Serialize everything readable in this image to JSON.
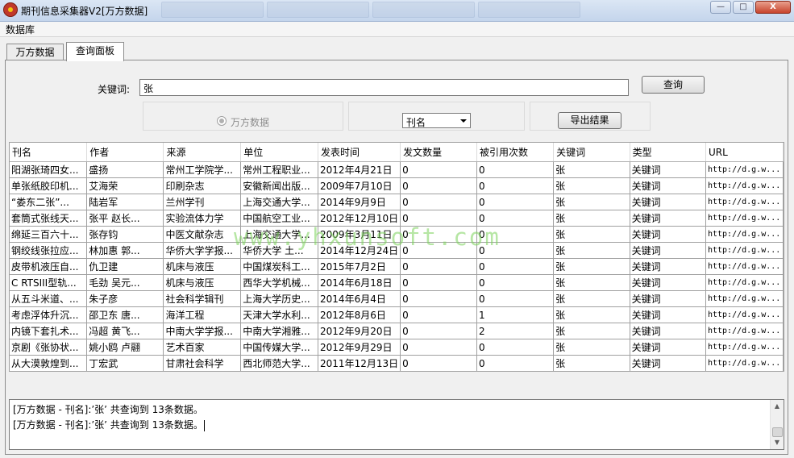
{
  "window": {
    "title": "期刊信息采集器V2[万方数据]",
    "controls": {
      "minimize": "—",
      "maximize": "□",
      "close": "X"
    }
  },
  "menu": {
    "items": [
      "数据库"
    ]
  },
  "tabs": [
    "万方数据",
    "查询面板"
  ],
  "search": {
    "label": "关键词:",
    "value": "张",
    "button": "查询"
  },
  "options": {
    "radio_label": "万方数据",
    "field_select": "刊名",
    "export_button": "导出结果"
  },
  "table": {
    "columns": [
      "刊名",
      "作者",
      "来源",
      "单位",
      "发表时间",
      "发文数量",
      "被引用次数",
      "关键词",
      "类型",
      "URL"
    ],
    "rows": [
      [
        "阳湖张琦四女...",
        "盛扬",
        "常州工学院学...",
        "常州工程职业...",
        "2012年4月21日",
        "0",
        "0",
        "张",
        "关键词",
        "http://d.g.w..."
      ],
      [
        "单张纸胶印机...",
        "艾海荣",
        "印刷杂志",
        "安徽新闻出版...",
        "2009年7月10日",
        "0",
        "0",
        "张",
        "关键词",
        "http://d.g.w..."
      ],
      [
        "“娄东二张”...",
        "陆岩军",
        "兰州学刊",
        "上海交通大学...",
        "2014年9月9日",
        "0",
        "0",
        "张",
        "关键词",
        "http://d.g.w..."
      ],
      [
        "套筒式张线天...",
        "张平    赵长...",
        "实验流体力学",
        "中国航空工业...",
        "2012年12月10日",
        "0",
        "0",
        "张",
        "关键词",
        "http://d.g.w..."
      ],
      [
        "绵延三百六十...",
        "张存钧",
        "中医文献杂志",
        "上海交通大学...",
        "2009年3月11日",
        "0",
        "0",
        "张",
        "关键词",
        "http://d.g.w..."
      ],
      [
        "钢绞线张拉应...",
        "林加惠    郭...",
        "华侨大学学报...",
        "华侨大学 土...",
        "2014年12月24日",
        "0",
        "0",
        "张",
        "关键词",
        "http://d.g.w..."
      ],
      [
        "皮带机液压自...",
        "仇卫建",
        "机床与液压",
        "中国煤炭科工...",
        "2015年7月2日",
        "0",
        "0",
        "张",
        "关键词",
        "http://d.g.w..."
      ],
      [
        "C RTSIII型轨...",
        "毛劲    吴元...",
        "机床与液压",
        "西华大学机械...",
        "2014年6月18日",
        "0",
        "0",
        "张",
        "关键词",
        "http://d.g.w..."
      ],
      [
        "从五斗米道、...",
        "朱子彦",
        "社会科学辑刊",
        "上海大学历史...",
        "2014年6月4日",
        "0",
        "0",
        "张",
        "关键词",
        "http://d.g.w..."
      ],
      [
        "考虑浮体升沉...",
        "邵卫东    唐...",
        "海洋工程",
        "天津大学水利...",
        "2012年8月6日",
        "0",
        "1",
        "张",
        "关键词",
        "http://d.g.w..."
      ],
      [
        "内镜下套扎术...",
        "冯超    黄飞...",
        "中南大学学报...",
        "中南大学湘雅...",
        "2012年9月20日",
        "0",
        "2",
        "张",
        "关键词",
        "http://d.g.w..."
      ],
      [
        "京剧《张协状...",
        "姚小鸥    卢翮",
        "艺术百家",
        "中国传媒大学...",
        "2012年9月29日",
        "0",
        "0",
        "张",
        "关键词",
        "http://d.g.w..."
      ],
      [
        "从大漠敦煌到...",
        "丁宏武",
        "甘肃社会科学",
        "西北师范大学...",
        "2011年12月13日",
        "0",
        "0",
        "张",
        "关键词",
        "http://d.g.w..."
      ]
    ]
  },
  "watermark": "www.yhxunsoft.com",
  "log": {
    "lines": [
      "[万方数据 - 刊名]:’张’ 共查询到 13条数据。",
      "[万方数据 - 刊名]:’张’ 共查询到 13条数据。"
    ]
  }
}
